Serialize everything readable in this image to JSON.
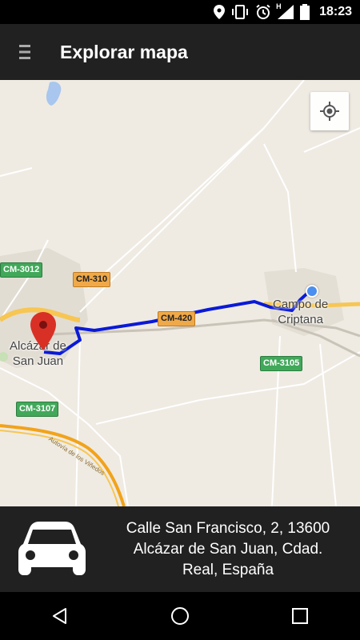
{
  "status_bar": {
    "time": "18:23",
    "icons": [
      "location-icon",
      "vibrate-icon",
      "alarm-icon",
      "signal-icon",
      "battery-icon"
    ],
    "network_label": "H"
  },
  "app_bar": {
    "title": "Explorar mapa",
    "menu_icon": "hamburger-menu-icon"
  },
  "map": {
    "locate_icon": "my-location-icon",
    "road_shields": [
      {
        "label": "CM-3012",
        "color": "#41a85a"
      },
      {
        "label": "CM-310",
        "color": "#f0a948"
      },
      {
        "label": "CM-420",
        "color": "#f0a948"
      },
      {
        "label": "CM-3105",
        "color": "#41a85a"
      },
      {
        "label": "CM-3107",
        "color": "#41a85a"
      }
    ],
    "towns": [
      {
        "line1": "Alcázar de",
        "line2": "San Juan"
      },
      {
        "line1": "Campo de",
        "line2": "Criptana"
      }
    ],
    "road_name": "Autovía de los Viñedos",
    "route_color": "#0a1ad6",
    "pin_color": "#d93025"
  },
  "info_panel": {
    "vehicle_icon": "car-icon",
    "address_lines": [
      "Calle San Francisco, 2, 13600",
      "Alcázar de San Juan, Cdad.",
      "Real, España"
    ]
  },
  "nav_bar": {
    "buttons": [
      "back-icon",
      "home-icon",
      "recents-icon"
    ]
  }
}
